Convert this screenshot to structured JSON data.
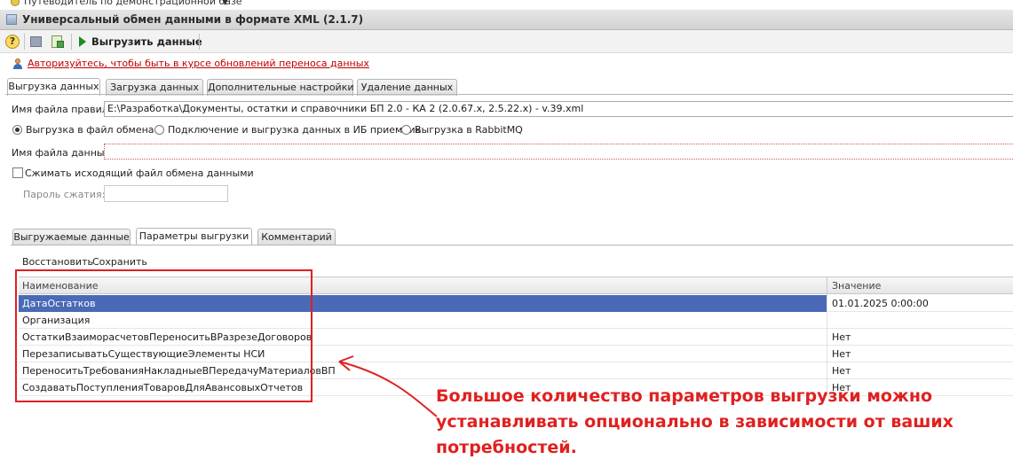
{
  "topbar": {
    "text": "Путеводитель по демонстрационной базе"
  },
  "window": {
    "title": "Универсальный обмен данными в формате XML (2.1.7)"
  },
  "toolbar": {
    "help_label": "?",
    "export_label": "Выгрузить данные"
  },
  "auth": {
    "link_text": "Авторизуйтесь, чтобы быть в курсе обновлений переноса данных"
  },
  "main_tabs": [
    {
      "label": "Выгрузка данных"
    },
    {
      "label": "Загрузка данных"
    },
    {
      "label": "Дополнительные настройки"
    },
    {
      "label": "Удаление данных"
    }
  ],
  "rules_file": {
    "label": "Имя файла правил:",
    "value": "E:\\Разработка\\Документы, остатки и справочники БП 2.0 - КА 2 (2.0.67.x, 2.5.22.x) - v.39.xml"
  },
  "export_mode": {
    "options": [
      {
        "label": "Выгрузка в файл обмена",
        "selected": true
      },
      {
        "label": "Подключение и выгрузка данных в ИБ приемник",
        "selected": false
      },
      {
        "label": "Выгрузка в RabbitMQ",
        "selected": false
      }
    ]
  },
  "data_file": {
    "label": "Имя файла данных:",
    "value": ""
  },
  "compress": {
    "label": "Сжимать исходящий файл обмена данными",
    "checked": false
  },
  "compress_password": {
    "label": "Пароль сжатия:",
    "value": ""
  },
  "inner_tabs": [
    {
      "label": "Выгружаемые данные"
    },
    {
      "label": "Параметры выгрузки"
    },
    {
      "label": "Комментарий"
    }
  ],
  "commands": {
    "restore": "Восстановить",
    "save": "Сохранить"
  },
  "params_table": {
    "columns": [
      "Наименование",
      "Значение"
    ],
    "rows": [
      {
        "name": "ДатаОстатков",
        "value": "01.01.2025 0:00:00"
      },
      {
        "name": "Организация",
        "value": ""
      },
      {
        "name": "ОстаткиВзаиморасчетовПереноситьВРазрезеДоговоров",
        "value": "Нет"
      },
      {
        "name": "ПерезаписыватьСуществующиеЭлементы НСИ",
        "value": "Нет"
      },
      {
        "name": "ПереноситьТребованияНакладныеВПередачуМатериаловВП",
        "value": "Нет"
      },
      {
        "name": "СоздаватьПоступленияТоваровДляАвансовыхОтчетов",
        "value": "Нет"
      }
    ]
  },
  "annotation": {
    "lines": [
      "Большое количество параметров выгрузки можно",
      "устанавливать опционально в зависимости от ваших",
      "потребностей."
    ],
    "color": "#e02020"
  },
  "colors": {
    "selection": "#4a6ab8",
    "highlight_box": "#e02020",
    "link": "#c00000"
  }
}
